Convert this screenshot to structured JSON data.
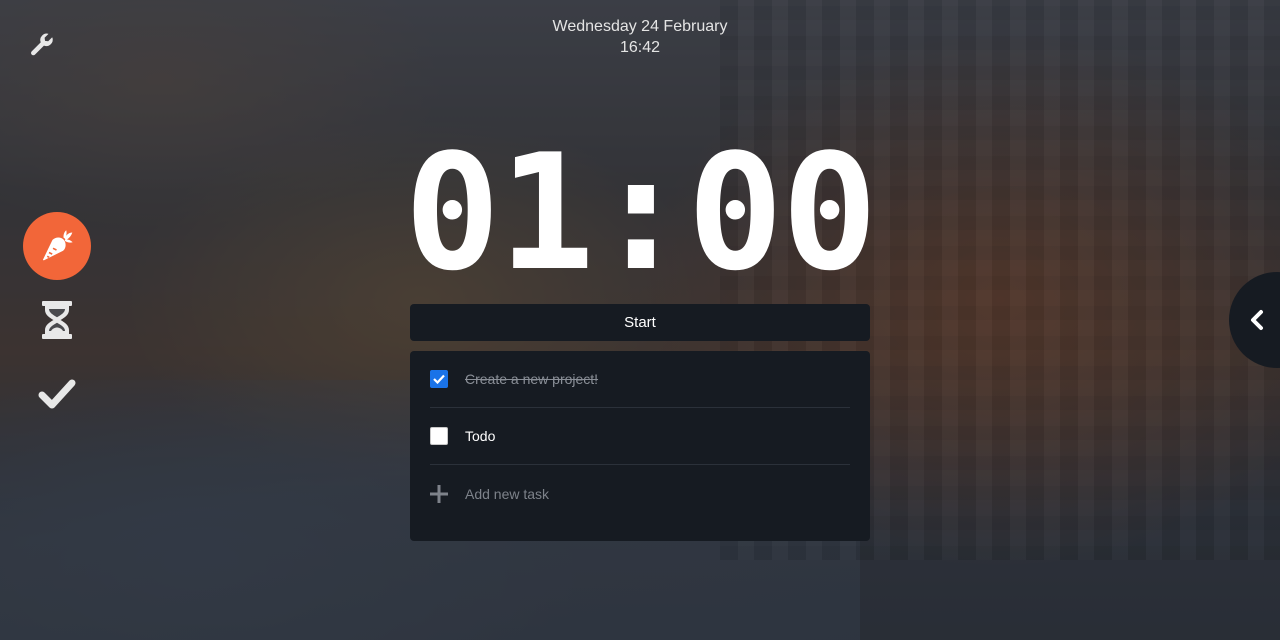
{
  "datetime": {
    "date": "Wednesday 24 February",
    "time": "16:42"
  },
  "sidebar": {
    "settings_icon": "wrench-icon",
    "modes": [
      {
        "name": "pomodoro",
        "icon": "carrot-icon",
        "active": true,
        "accent": "#f26639"
      },
      {
        "name": "timer",
        "icon": "hourglass-icon",
        "active": false
      },
      {
        "name": "tasks",
        "icon": "checkmark-icon",
        "active": false
      }
    ]
  },
  "timer": {
    "display": "01:00"
  },
  "controls": {
    "start_label": "Start"
  },
  "tasks": {
    "items": [
      {
        "label": "Create a new project!",
        "completed": true
      },
      {
        "label": "Todo",
        "completed": false
      }
    ],
    "add_placeholder": "Add new task"
  },
  "drawer": {
    "icon": "chevron-left-icon"
  },
  "colors": {
    "panel": "#161b22",
    "accent": "#f26639",
    "checkbox_checked": "#1a73e8"
  }
}
